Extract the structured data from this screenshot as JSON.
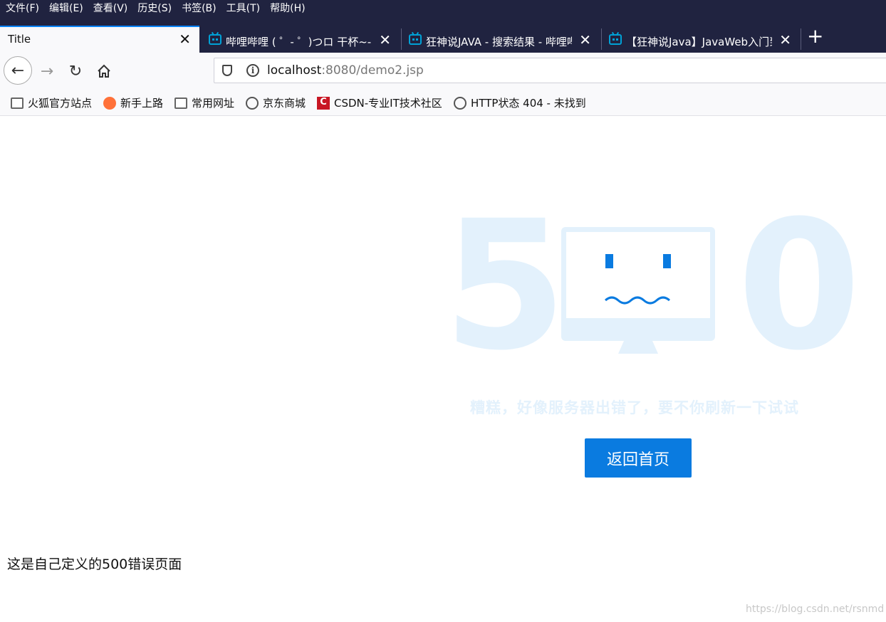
{
  "menu": [
    "文件(F)",
    "编辑(E)",
    "查看(V)",
    "历史(S)",
    "书签(B)",
    "工具(T)",
    "帮助(H)"
  ],
  "tabs": [
    {
      "title": "Title",
      "close": "✕"
    },
    {
      "title": "哔哩哔哩 ( ゜- ゜)つロ 干杯~-bi",
      "close": "✕"
    },
    {
      "title": "狂神说JAVA - 搜索结果 - 哔哩哔",
      "close": "✕"
    },
    {
      "title": "【狂神说Java】JavaWeb入门到",
      "close": "✕"
    }
  ],
  "new_tab": "+",
  "url": {
    "host": "localhost",
    "rest": ":8080/demo2.jsp"
  },
  "bookmarks": [
    {
      "label": "火狐官方站点",
      "icon": "folder-icon"
    },
    {
      "label": "新手上路",
      "icon": "firefox-icon"
    },
    {
      "label": "常用网址",
      "icon": "folder-icon"
    },
    {
      "label": "京东商城",
      "icon": "globe-icon"
    },
    {
      "label": "CSDN-专业IT技术社区",
      "icon": "csdn-icon"
    },
    {
      "label": "HTTP状态 404 - 未找到",
      "icon": "globe-icon"
    }
  ],
  "page": {
    "digit_left": "5",
    "digit_right": "0",
    "message": "糟糕，好像服务器出错了，要不你刷新一下试试",
    "home_button": "返回首页",
    "custom_text": "这是自己定义的500错误页面",
    "watermark": "https://blog.csdn.net/rsnmd"
  },
  "colors": {
    "accent": "#0a7be0",
    "light": "#e3f1fc",
    "chrome": "#202340"
  }
}
